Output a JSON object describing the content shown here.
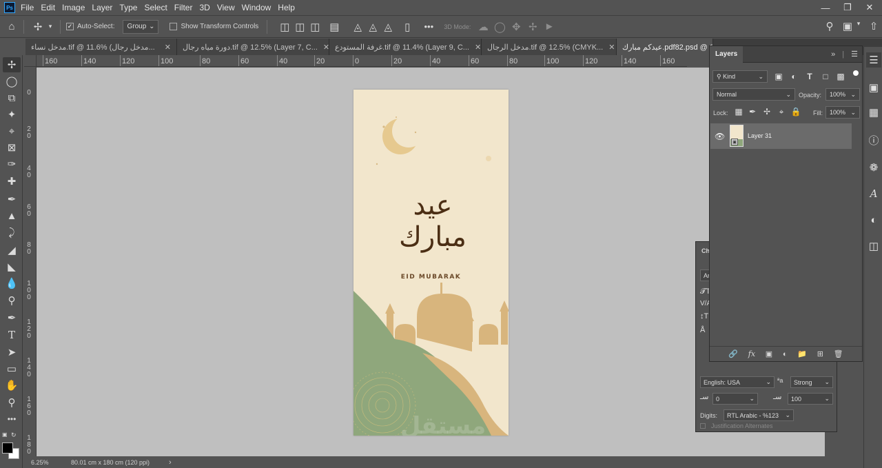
{
  "menubar": {
    "logo": "Ps",
    "items": [
      "File",
      "Edit",
      "Image",
      "Layer",
      "Type",
      "Select",
      "Filter",
      "3D",
      "View",
      "Window",
      "Help"
    ]
  },
  "options": {
    "auto_select_label": "Auto-Select:",
    "auto_select_checked": true,
    "group_value": "Group",
    "show_transform_label": "Show Transform Controls",
    "show_transform_checked": false,
    "mode_3d_label": "3D Mode:"
  },
  "tabs": [
    {
      "label": "مدخل نساء.tif @ 11.6% (مدخل رجال...",
      "active": false
    },
    {
      "label": "دورة مياه رجال.tif @ 12.5% (Layer 7, C...",
      "active": false
    },
    {
      "label": "غرفة المستودع.tif @ 11.4% (Layer 9, C...",
      "active": false
    },
    {
      "label": "مدخل الرجال.tif @ 12.5% (CMYK...",
      "active": false
    },
    {
      "label": "عيدكم مبارك.pdf82.psd @ 6",
      "active": true
    }
  ],
  "ruler_h": [
    "160",
    "140",
    "120",
    "100",
    "80",
    "60",
    "40",
    "20",
    "0",
    "20",
    "40",
    "60",
    "80",
    "100",
    "120",
    "140",
    "160"
  ],
  "ruler_v": [
    "0",
    "2 0",
    "4 0",
    "6 0",
    "8 0",
    "1 0 0",
    "1 2 0",
    "1 4 0",
    "1 6 0",
    "1 8 0"
  ],
  "artwork": {
    "arabic_line1": "عيد",
    "arabic_line2": "مبارك",
    "caption": "EID MUBARAK",
    "watermark": "مستقل",
    "colors": {
      "background": "#f2e6cc",
      "green": "#8fa77c",
      "sand": "#d8b57d",
      "brown": "#4b2e14"
    }
  },
  "status": {
    "zoom": "6.25%",
    "doc_info": "80.01 cm x 180 cm (120 ppi)"
  },
  "layers_panel": {
    "tab_label": "Layers",
    "kind_label": "Kind",
    "blend_mode": "Normal",
    "opacity_label": "Opacity:",
    "opacity_value": "100%",
    "lock_label": "Lock:",
    "fill_label": "Fill:",
    "fill_value": "100%",
    "layers": [
      {
        "name": "Layer 31",
        "visible": true,
        "selected": true
      }
    ]
  },
  "character_panel": {
    "title_fragment": "Ch",
    "font_fragment": "Ar",
    "language": "English: USA",
    "antialias_label": "ªa",
    "antialias_value": "Strong",
    "kashida_value": "0",
    "tracking_value": "100",
    "digits_label": "Digits:",
    "digits_value": "RTL Arabic - %123",
    "justification_label": "Justification Alternates"
  }
}
